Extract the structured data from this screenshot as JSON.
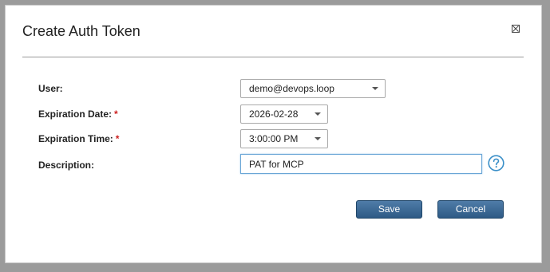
{
  "dialog": {
    "title": "Create Auth Token"
  },
  "form": {
    "user": {
      "label": "User:",
      "value": "demo@devops.loop"
    },
    "expiration_date": {
      "label": "Expiration Date:",
      "required_mark": "*",
      "value": "2026-02-28"
    },
    "expiration_time": {
      "label": "Expiration Time:",
      "required_mark": "*",
      "value": "3:00:00 PM"
    },
    "description": {
      "label": "Description:",
      "value": "PAT for MCP"
    }
  },
  "buttons": {
    "save": "Save",
    "cancel": "Cancel"
  },
  "icons": {
    "close": "close-icon",
    "help": "help-icon",
    "dropdown": "chevron-down-icon"
  },
  "colors": {
    "button": "#3a6791",
    "required": "#cc1f1f",
    "help_icon": "#3a8fc8",
    "focus_border": "#6aa6d6"
  }
}
